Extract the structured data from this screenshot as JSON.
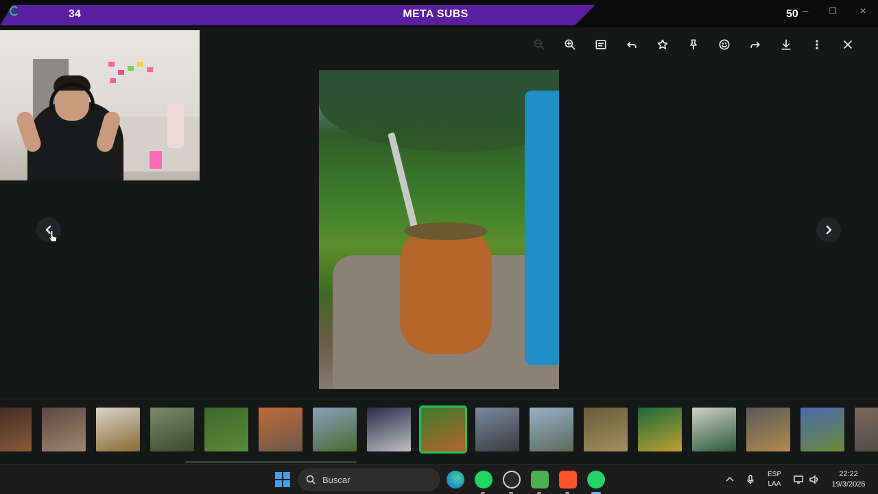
{
  "overlay": {
    "left_count": "34",
    "title": "META SUBS",
    "right_count": "50"
  },
  "toolbar": {
    "buttons": [
      "zoom-out",
      "zoom-in",
      "caption",
      "reply",
      "star",
      "pin",
      "react",
      "forward",
      "download",
      "more",
      "close"
    ]
  },
  "taskbar": {
    "search_placeholder": "Buscar",
    "language": "ESP",
    "layout": "LAA",
    "time": "22:22",
    "date": "19/3/2026"
  },
  "colors": {
    "accent_green": "#21c063",
    "overlay_purple": "#5a1ea0",
    "background": "#161717"
  },
  "thumbnails": [
    {
      "name": "thumb-1",
      "colors": [
        "#3d2a20",
        "#8a5a3a"
      ]
    },
    {
      "name": "thumb-2",
      "colors": [
        "#5a4a40",
        "#a08570"
      ]
    },
    {
      "name": "thumb-3",
      "colors": [
        "#d8d4cc",
        "#8a6a30"
      ]
    },
    {
      "name": "thumb-4",
      "colors": [
        "#7a8a6a",
        "#3a4a2a"
      ]
    },
    {
      "name": "thumb-5",
      "colors": [
        "#3a6a2a",
        "#5a8a3a"
      ]
    },
    {
      "name": "thumb-6",
      "colors": [
        "#c06a3a",
        "#6a5a4a"
      ]
    },
    {
      "name": "thumb-7",
      "colors": [
        "#8aa0c0",
        "#4a6a30"
      ]
    },
    {
      "name": "thumb-8",
      "colors": [
        "#2a2a4a",
        "#c0c0c0"
      ]
    },
    {
      "name": "thumb-9",
      "colors": [
        "#3d7c2b",
        "#b4652a"
      ]
    },
    {
      "name": "thumb-10",
      "colors": [
        "#7a8aa0",
        "#3a3a3a"
      ]
    },
    {
      "name": "thumb-11",
      "colors": [
        "#9ab0c8",
        "#5a6a5a"
      ]
    },
    {
      "name": "thumb-12",
      "colors": [
        "#6a5a3a",
        "#a09060"
      ]
    },
    {
      "name": "thumb-13",
      "colors": [
        "#1a6a3a",
        "#c0a030"
      ]
    },
    {
      "name": "thumb-14",
      "colors": [
        "#d0d0c8",
        "#2a5a3a"
      ]
    },
    {
      "name": "thumb-15",
      "colors": [
        "#5a5a5a",
        "#b08a4a"
      ]
    },
    {
      "name": "thumb-16",
      "colors": [
        "#4a6ab0",
        "#6a8a3a"
      ]
    },
    {
      "name": "thumb-17",
      "colors": [
        "#7a6a5a",
        "#4a4a4a"
      ]
    }
  ]
}
